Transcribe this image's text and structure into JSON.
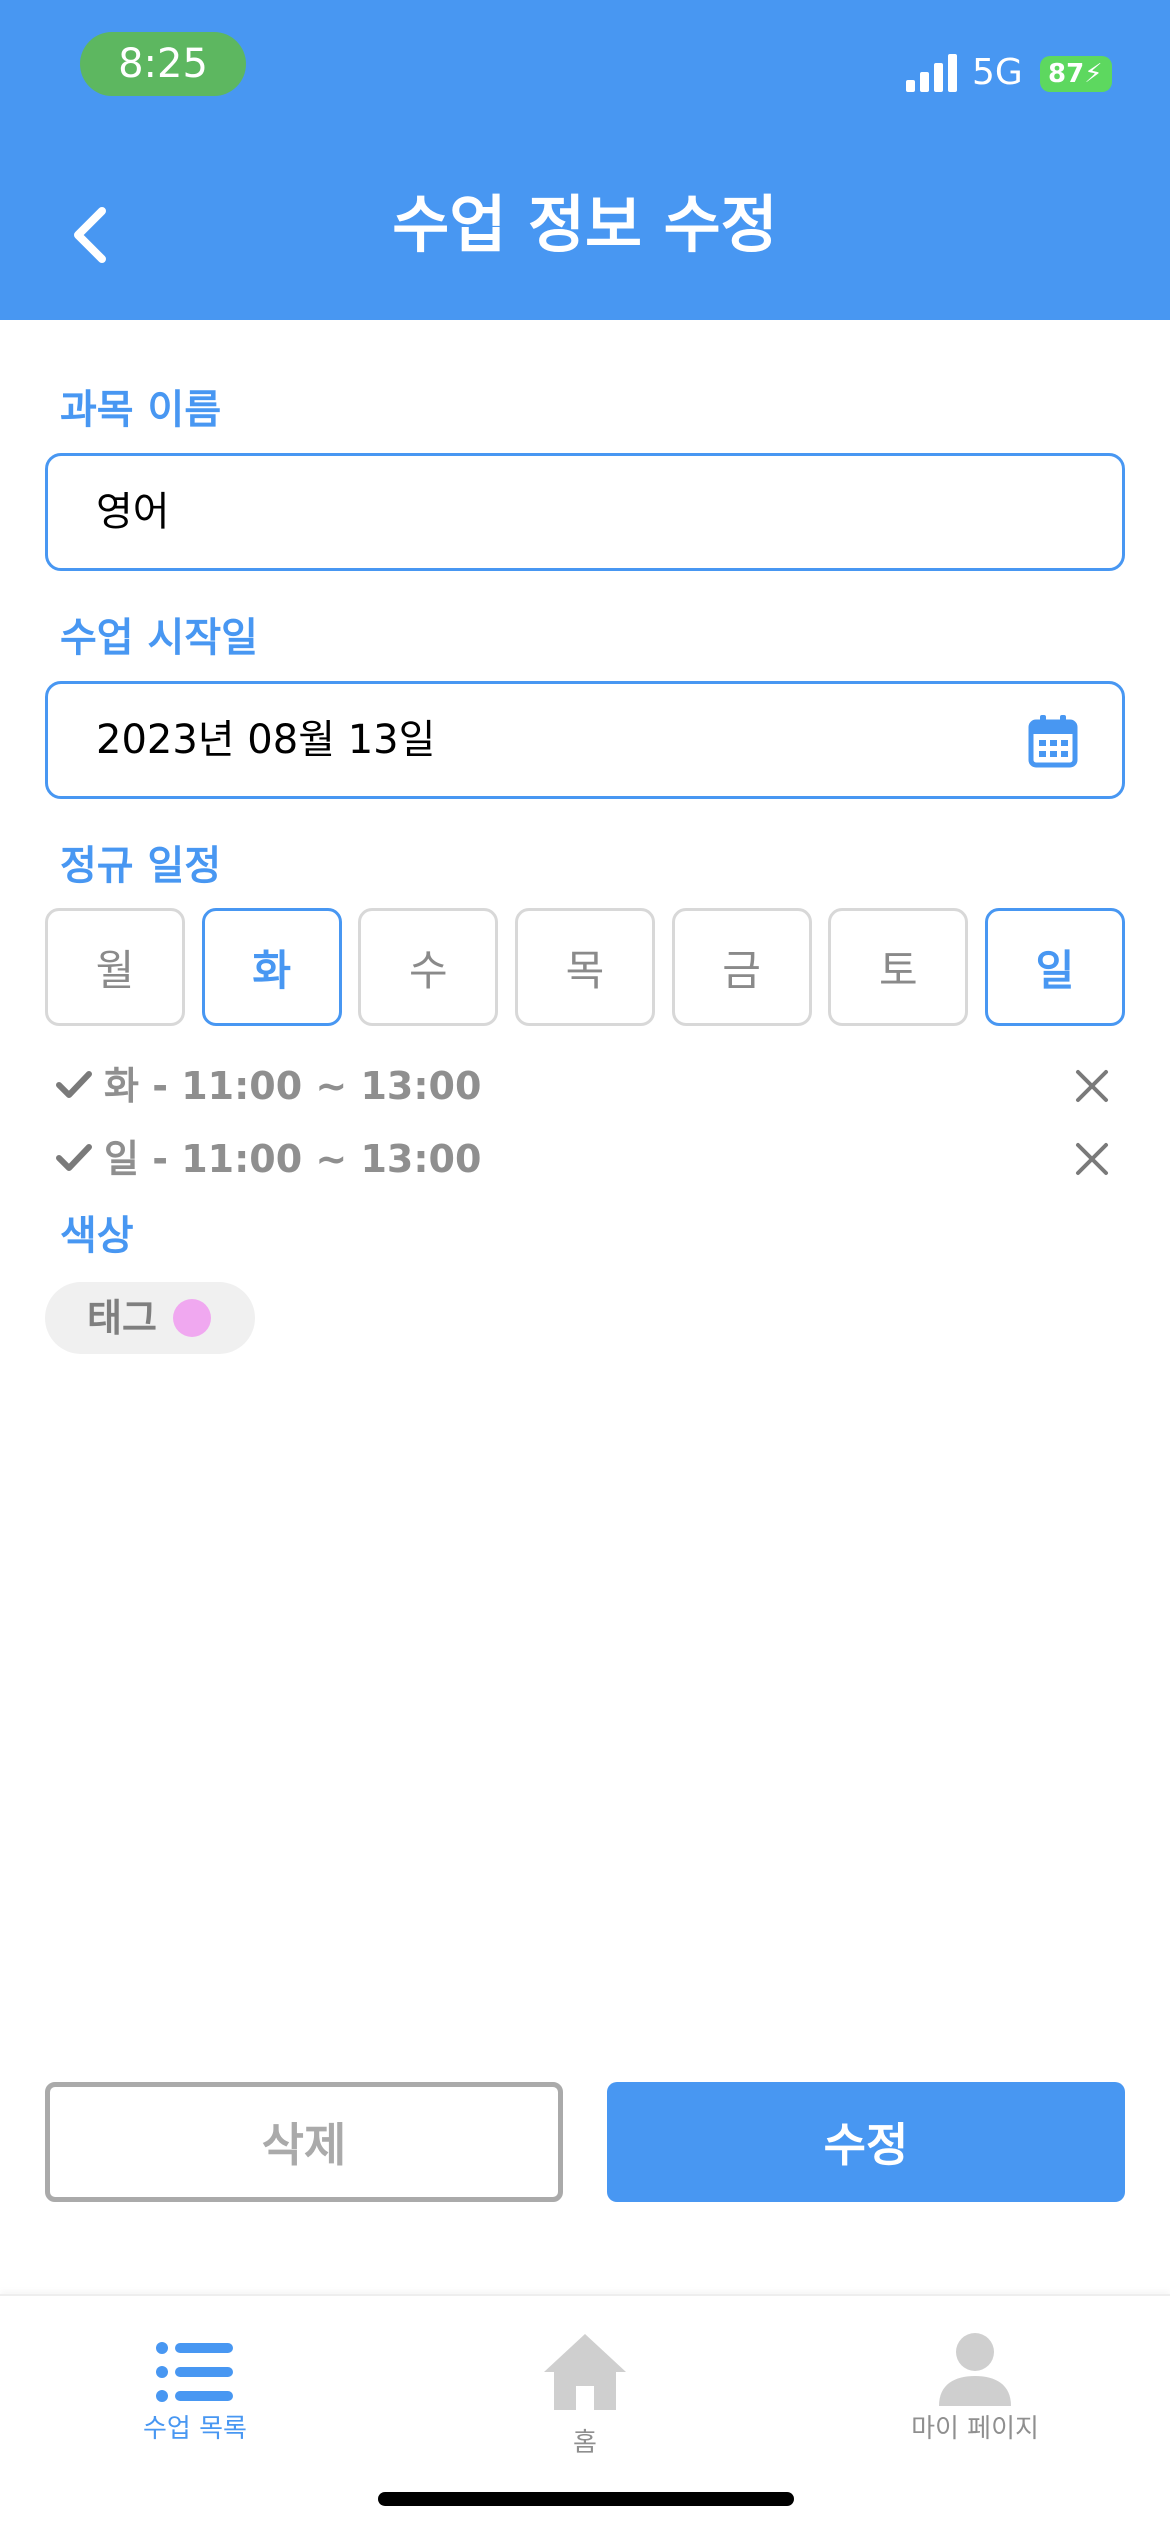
{
  "status_bar": {
    "time": "8:25",
    "network": "5G",
    "battery": "87"
  },
  "header": {
    "title": "수업 정보 수정",
    "back_icon": "chevron-left-icon"
  },
  "form": {
    "subject_label": "과목 이름",
    "subject_value": "영어",
    "start_date_label": "수업 시작일",
    "start_date_value": "2023년 08월 13일",
    "calendar_icon": "calendar-icon",
    "schedule_label": "정규 일정",
    "days": [
      {
        "label": "월",
        "selected": false
      },
      {
        "label": "화",
        "selected": true
      },
      {
        "label": "수",
        "selected": false
      },
      {
        "label": "목",
        "selected": false
      },
      {
        "label": "금",
        "selected": false
      },
      {
        "label": "토",
        "selected": false
      },
      {
        "label": "일",
        "selected": true
      }
    ],
    "schedules": [
      {
        "text": "화 - 11:00 ~ 13:00"
      },
      {
        "text": "일 - 11:00 ~ 13:00"
      }
    ],
    "color_label": "색상",
    "tag_label": "태그",
    "tag_color": "#F0A8F0"
  },
  "actions": {
    "delete_label": "삭제",
    "edit_label": "수정"
  },
  "tabbar": {
    "tabs": [
      {
        "label": "수업 목록",
        "icon": "list-icon",
        "active": true
      },
      {
        "label": "홈",
        "icon": "home-icon",
        "active": false
      },
      {
        "label": "마이 페이지",
        "icon": "person-icon",
        "active": false
      }
    ]
  },
  "colors": {
    "primary": "#4897F2",
    "status_green": "#5DB760",
    "muted": "#8f8f8f"
  }
}
